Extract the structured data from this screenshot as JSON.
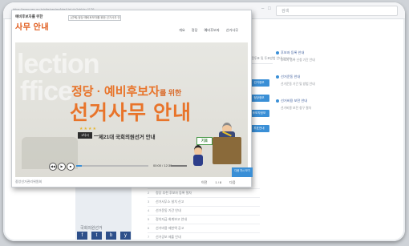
{
  "browser": {
    "url": "https://www.nec.go.kr/site/nec/ex/bbs/List.do?cbIdx=1176",
    "search_placeholder": "검색"
  },
  "background": {
    "top_note": "사전투표 및 투표방법 안내 (2024)",
    "buttons": [
      "선거정보",
      "정당정보",
      "후보자정보",
      "투표안내"
    ],
    "right_panel": [
      {
        "title": "후보자 등록 안내",
        "sub": "후보자 등록 신청 기간 안내"
      },
      {
        "title": "선거운동 안내",
        "sub": "선거운동 기간 및 방법 안내"
      },
      {
        "title": "선거비용 보전 안내",
        "sub": "선거비용 보전 청구 절차"
      }
    ],
    "list_items": [
      {
        "n": "1",
        "text": "예비후보자 등록 신청 방법 안내"
      },
      {
        "n": "2",
        "text": "정당 추천 후보자 등록 절차"
      },
      {
        "n": "3",
        "text": "선거사무소 설치 신고"
      },
      {
        "n": "4",
        "text": "선거운동 기간 안내"
      },
      {
        "n": "5",
        "text": "정치자금 회계보고 안내"
      },
      {
        "n": "6",
        "text": "선거비용 제한액 공고"
      },
      {
        "n": "7",
        "text": "선거공보 제출 안내"
      }
    ],
    "sidebar_heading": "국회의원선거",
    "social": [
      "f",
      "t",
      "b",
      "y"
    ]
  },
  "popup": {
    "logo_small": "예비후보자를 위한",
    "logo_big": "사무 안내",
    "select_value": "[선택] 정당·예비후보자를 위한 선거사무 안내",
    "top_nav": [
      "개요",
      "정당",
      "예비후보자",
      "선거사무"
    ],
    "bg_word_1": "lection",
    "bg_word_2": "ffice",
    "headline_1": "정당 · 예비후보자",
    "headline_1_small": "를 위한",
    "headline_2": "선거사무 안내",
    "stars": "★★★★",
    "badge": "1차시",
    "subtitle": "제21대 국회의원선거 안내",
    "sign_text": "기호",
    "time": "00:00 / 12:30",
    "progress_fraction": 0.08,
    "cta_label": "다음 차시 보기",
    "nav_prev": "이전",
    "page_indicator": "1 / 8",
    "nav_next": "다음",
    "footer": "중앙선거관리위원회"
  }
}
